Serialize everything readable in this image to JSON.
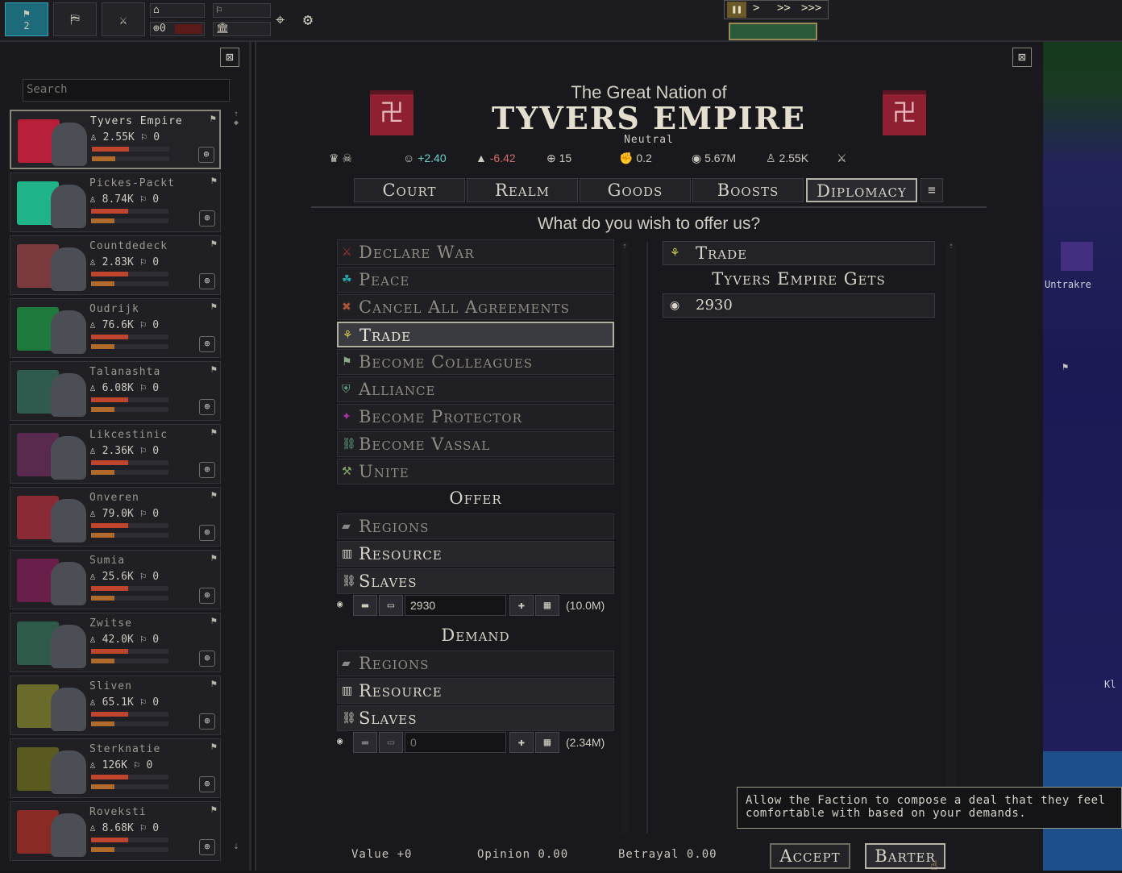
{
  "topbar": {
    "flag_count": "2",
    "money": "0",
    "speed_buttons": [
      "❚❚",
      ">",
      ">>",
      ">>>"
    ]
  },
  "left": {
    "search_placeholder": "Search",
    "factions": [
      {
        "name": "Tyvers Empire",
        "pop": "2.55K",
        "val": "0",
        "color": "#b8203a",
        "selected": true
      },
      {
        "name": "Pickes-Packt",
        "pop": "8.74K",
        "val": "0",
        "color": "#1fb38a",
        "selected": false
      },
      {
        "name": "Countdedeck",
        "pop": "2.83K",
        "val": "0",
        "color": "#7a3a3e",
        "selected": false
      },
      {
        "name": "Oudrijk",
        "pop": "76.6K",
        "val": "0",
        "color": "#1f7a3d",
        "selected": false
      },
      {
        "name": "Talanashta",
        "pop": "6.08K",
        "val": "0",
        "color": "#2f5a4e",
        "selected": false
      },
      {
        "name": "Likcestinic",
        "pop": "2.36K",
        "val": "0",
        "color": "#5a2a4e",
        "selected": false
      },
      {
        "name": "Onveren",
        "pop": "79.0K",
        "val": "0",
        "color": "#8a2a35",
        "selected": false
      },
      {
        "name": "Sumia",
        "pop": "25.6K",
        "val": "0",
        "color": "#6a1f4a",
        "selected": false
      },
      {
        "name": "Zwitse",
        "pop": "42.0K",
        "val": "0",
        "color": "#2e5a4a",
        "selected": false
      },
      {
        "name": "Sliven",
        "pop": "65.1K",
        "val": "0",
        "color": "#6a6a2a",
        "selected": false
      },
      {
        "name": "Sterknatie",
        "pop": "126K",
        "val": "0",
        "color": "#5a5a20",
        "selected": false
      },
      {
        "name": "Roveksti",
        "pop": "8.68K",
        "val": "0",
        "color": "#8a2a25",
        "selected": false
      }
    ]
  },
  "header": {
    "subtitle": "The Great Nation of",
    "title": "TYVERS EMPIRE",
    "status": "Neutral",
    "stats": {
      "happiness": "+2.40",
      "danger": "-6.42",
      "crosshair": "15",
      "fist": "0.2",
      "coins": "5.67M",
      "pop": "2.55K"
    }
  },
  "tabs": [
    "Court",
    "Realm",
    "Goods",
    "Boosts",
    "Diplomacy"
  ],
  "question": "What do you wish to offer us?",
  "options": [
    {
      "label": "Declare War",
      "icon": "⚔",
      "color": "#a33"
    },
    {
      "label": "Peace",
      "icon": "☘",
      "color": "#2aa"
    },
    {
      "label": "Cancel All Agreements",
      "icon": "✖",
      "color": "#a53"
    },
    {
      "label": "Trade",
      "icon": "⚘",
      "color": "#cc4"
    },
    {
      "label": "Become Colleagues",
      "icon": "⚑",
      "color": "#8a8"
    },
    {
      "label": "Alliance",
      "icon": "⛨",
      "color": "#6a8"
    },
    {
      "label": "Become Protector",
      "icon": "✦",
      "color": "#a3a"
    },
    {
      "label": "Become Vassal",
      "icon": "⛓",
      "color": "#6a8"
    },
    {
      "label": "Unite",
      "icon": "⚒",
      "color": "#8a6"
    }
  ],
  "offer": {
    "heading": "Offer",
    "items": [
      "Regions",
      "Resource",
      "Slaves"
    ],
    "amount": "2930",
    "total": "(10.0M)"
  },
  "demand": {
    "heading": "Demand",
    "items": [
      "Regions",
      "Resource",
      "Slaves"
    ],
    "amount": "0",
    "total": "(2.34M)"
  },
  "right": {
    "trade_label": "Trade",
    "gets_heading": "Tyvers Empire Gets",
    "gets_value": "2930"
  },
  "footer": {
    "value": "Value +0",
    "opinion": "Opinion 0.00",
    "betrayal": "Betrayal 0.00",
    "accept": "Accept",
    "barter": "Barter"
  },
  "tooltip": "Allow the Faction to compose a deal that they feel comfortable with based on your demands.",
  "map": {
    "label1": "Untrakre",
    "label2": "Kl"
  }
}
